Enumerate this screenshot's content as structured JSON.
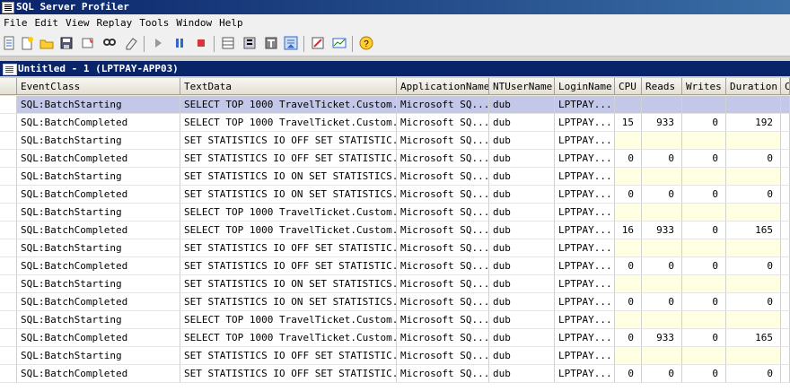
{
  "app": {
    "title": "SQL Server Profiler"
  },
  "menu": [
    "File",
    "Edit",
    "View",
    "Replay",
    "Tools",
    "Window",
    "Help"
  ],
  "toolbar": [
    "new-trace-icon",
    "new-template-icon",
    "open-icon",
    "save-icon",
    "properties-icon",
    "find-icon",
    "clear-icon",
    "run-icon",
    "pause-icon",
    "stop-icon",
    "columns-icon",
    "aggregated-icon",
    "groupby-icon",
    "auto-scroll-icon",
    "sql-server-icon",
    "performance-monitor-icon",
    "help-icon"
  ],
  "document": {
    "title": "Untitled - 1 (LPTPAY-APP03)"
  },
  "grid": {
    "columns": [
      "EventClass",
      "TextData",
      "ApplicationName",
      "NTUserName",
      "LoginName",
      "CPU",
      "Reads",
      "Writes",
      "Duration",
      "C"
    ],
    "rows": [
      {
        "event": "SQL:BatchStarting",
        "text": "SELECT TOP 1000 TravelTicket.Custom...",
        "app": "Microsoft SQ...",
        "nt": "dub",
        "login": "LPTPAY...",
        "cpu": "",
        "reads": "",
        "writes": "",
        "duration": ""
      },
      {
        "event": "SQL:BatchCompleted",
        "text": "SELECT TOP 1000 TravelTicket.Custom...",
        "app": "Microsoft SQ...",
        "nt": "dub",
        "login": "LPTPAY...",
        "cpu": "15",
        "reads": "933",
        "writes": "0",
        "duration": "192"
      },
      {
        "event": "SQL:BatchStarting",
        "text": "SET STATISTICS IO OFF SET STATISTIC...",
        "app": "Microsoft SQ...",
        "nt": "dub",
        "login": "LPTPAY...",
        "cpu": "",
        "reads": "",
        "writes": "",
        "duration": ""
      },
      {
        "event": "SQL:BatchCompleted",
        "text": "SET STATISTICS IO OFF SET STATISTIC...",
        "app": "Microsoft SQ...",
        "nt": "dub",
        "login": "LPTPAY...",
        "cpu": "0",
        "reads": "0",
        "writes": "0",
        "duration": "0"
      },
      {
        "event": "SQL:BatchStarting",
        "text": "SET STATISTICS IO ON SET STATISTICS...",
        "app": "Microsoft SQ...",
        "nt": "dub",
        "login": "LPTPAY...",
        "cpu": "",
        "reads": "",
        "writes": "",
        "duration": ""
      },
      {
        "event": "SQL:BatchCompleted",
        "text": "SET STATISTICS IO ON SET STATISTICS...",
        "app": "Microsoft SQ...",
        "nt": "dub",
        "login": "LPTPAY...",
        "cpu": "0",
        "reads": "0",
        "writes": "0",
        "duration": "0"
      },
      {
        "event": "SQL:BatchStarting",
        "text": "SELECT TOP 1000 TravelTicket.Custom...",
        "app": "Microsoft SQ...",
        "nt": "dub",
        "login": "LPTPAY...",
        "cpu": "",
        "reads": "",
        "writes": "",
        "duration": ""
      },
      {
        "event": "SQL:BatchCompleted",
        "text": "SELECT TOP 1000 TravelTicket.Custom...",
        "app": "Microsoft SQ...",
        "nt": "dub",
        "login": "LPTPAY...",
        "cpu": "16",
        "reads": "933",
        "writes": "0",
        "duration": "165"
      },
      {
        "event": "SQL:BatchStarting",
        "text": "SET STATISTICS IO OFF SET STATISTIC...",
        "app": "Microsoft SQ...",
        "nt": "dub",
        "login": "LPTPAY...",
        "cpu": "",
        "reads": "",
        "writes": "",
        "duration": ""
      },
      {
        "event": "SQL:BatchCompleted",
        "text": "SET STATISTICS IO OFF SET STATISTIC...",
        "app": "Microsoft SQ...",
        "nt": "dub",
        "login": "LPTPAY...",
        "cpu": "0",
        "reads": "0",
        "writes": "0",
        "duration": "0"
      },
      {
        "event": "SQL:BatchStarting",
        "text": "SET STATISTICS IO ON SET STATISTICS...",
        "app": "Microsoft SQ...",
        "nt": "dub",
        "login": "LPTPAY...",
        "cpu": "",
        "reads": "",
        "writes": "",
        "duration": ""
      },
      {
        "event": "SQL:BatchCompleted",
        "text": "SET STATISTICS IO ON SET STATISTICS...",
        "app": "Microsoft SQ...",
        "nt": "dub",
        "login": "LPTPAY...",
        "cpu": "0",
        "reads": "0",
        "writes": "0",
        "duration": "0"
      },
      {
        "event": "SQL:BatchStarting",
        "text": "SELECT TOP 1000 TravelTicket.Custom...",
        "app": "Microsoft SQ...",
        "nt": "dub",
        "login": "LPTPAY...",
        "cpu": "",
        "reads": "",
        "writes": "",
        "duration": ""
      },
      {
        "event": "SQL:BatchCompleted",
        "text": "SELECT TOP 1000 TravelTicket.Custom...",
        "app": "Microsoft SQ...",
        "nt": "dub",
        "login": "LPTPAY...",
        "cpu": "0",
        "reads": "933",
        "writes": "0",
        "duration": "165"
      },
      {
        "event": "SQL:BatchStarting",
        "text": "SET STATISTICS IO OFF SET STATISTIC...",
        "app": "Microsoft SQ...",
        "nt": "dub",
        "login": "LPTPAY...",
        "cpu": "",
        "reads": "",
        "writes": "",
        "duration": ""
      },
      {
        "event": "SQL:BatchCompleted",
        "text": "SET STATISTICS IO OFF SET STATISTIC...",
        "app": "Microsoft SQ...",
        "nt": "dub",
        "login": "LPTPAY...",
        "cpu": "0",
        "reads": "0",
        "writes": "0",
        "duration": "0"
      }
    ]
  }
}
